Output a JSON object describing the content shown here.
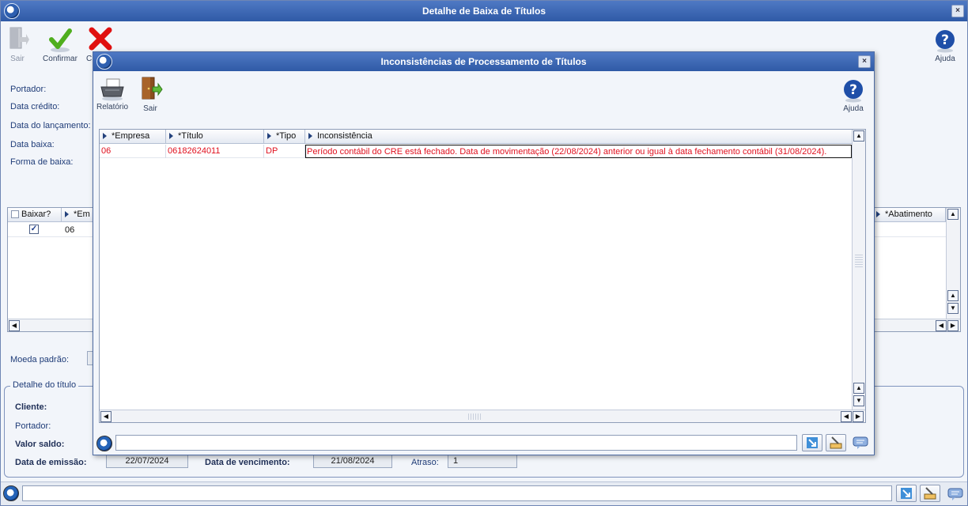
{
  "main_window": {
    "title": "Detalhe de Baixa de Títulos",
    "close_label": "×",
    "toolbar": {
      "sair": "Sair",
      "confirmar": "Confirmar",
      "cancelar": "C",
      "ajuda": "Ajuda"
    },
    "form": {
      "portador_label": "Portador:",
      "data_credito_label": "Data crédito:",
      "data_lancamento_label": "Data do lançamento:",
      "data_baixa_label": "Data baixa:",
      "forma_baixa_label": "Forma de  baixa:"
    },
    "grid": {
      "headers": [
        "Baixar?",
        "*Em",
        "*Abatimento"
      ],
      "row": {
        "checked": true,
        "empresa": "06"
      }
    },
    "moeda_padrao_label": "Moeda padrão:",
    "detalhe_titulo": {
      "legend": "Detalhe do título",
      "cliente_label": "Cliente:",
      "portador_label": "Portador:",
      "valor_saldo_label": "Valor saldo:",
      "data_emissao_label": "Data de emissão:",
      "data_emissao_value": "22/07/2024",
      "data_vencimento_label": "Data de vencimento:",
      "data_vencimento_value": "21/08/2024",
      "atraso_label": "Atraso:",
      "atraso_value": "1"
    }
  },
  "modal": {
    "title": "Inconsistências de Processamento de Títulos",
    "close_label": "×",
    "toolbar": {
      "relatorio": "Relatório",
      "sair": "Sair",
      "ajuda": "Ajuda"
    },
    "grid": {
      "headers": [
        "*Empresa",
        "*Título",
        "*Tipo",
        "Inconsistência"
      ],
      "rows": [
        {
          "empresa": "06",
          "titulo": "06182624011",
          "tipo": "DP",
          "inconsistencia": "Período contábil do CRE está fechado. Data de movimentação (22/08/2024) anterior ou igual à data fechamento contábil (31/08/2024)."
        }
      ]
    }
  },
  "colors": {
    "titlebar": "#3a66b3",
    "error_text": "#e0101e",
    "confirm_green": "#4fae1e",
    "cancel_red": "#e01010",
    "help_blue": "#1f4fa8"
  }
}
